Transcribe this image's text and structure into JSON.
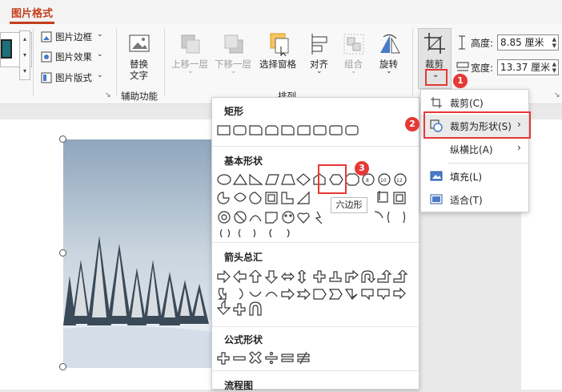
{
  "tab": {
    "label": "图片格式"
  },
  "ribbon": {
    "border_label": "图片边框",
    "effects_label": "图片效果",
    "layout_label": "图片版式",
    "alt_text_label": "替换\n文字",
    "alt_text_line1": "替换",
    "alt_text_line2": "文字",
    "accessibility_group": "辅助功能",
    "bring_forward": "上移一层",
    "send_backward": "下移一层",
    "selection_pane": "选择窗格",
    "align": "对齐",
    "group": "组合",
    "rotate": "旋转",
    "arrange_group": "排列",
    "crop": "裁剪",
    "height_label": "高度:",
    "height_value": "8.85 厘米",
    "width_label": "宽度:",
    "width_value": "13.37 厘米"
  },
  "shapes_gallery": {
    "sections": [
      "矩形",
      "基本形状",
      "箭头总汇",
      "公式形状",
      "流程图"
    ],
    "tooltip": "六边形"
  },
  "crop_menu": {
    "items": [
      "裁剪(C)",
      "裁剪为形状(S)",
      "纵横比(A)",
      "填充(L)",
      "适合(T)"
    ]
  },
  "badges": [
    "1",
    "2",
    "3"
  ],
  "colors": {
    "accent": "#c43e1c",
    "highlight": "#e53935"
  }
}
